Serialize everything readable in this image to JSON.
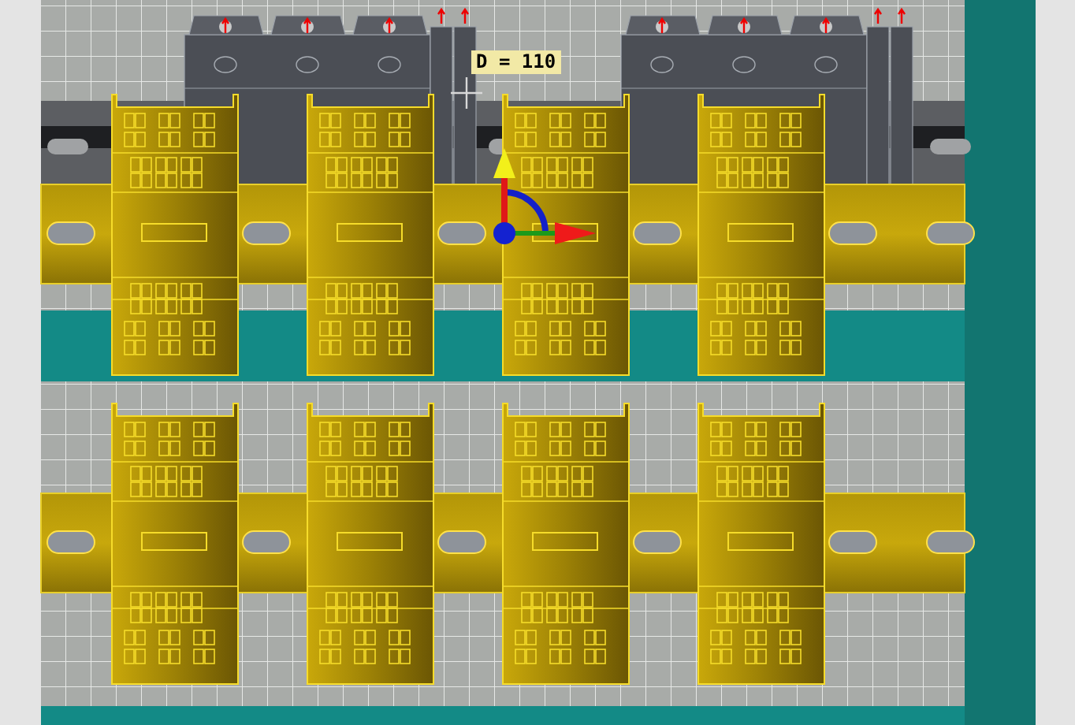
{
  "viewport": {
    "dimension_label": "D = 110"
  }
}
